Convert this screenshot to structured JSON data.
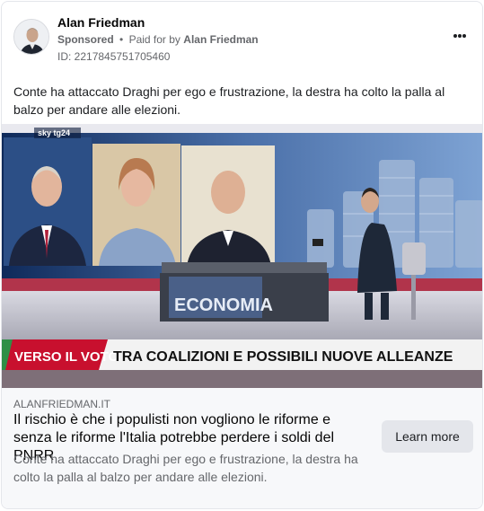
{
  "post": {
    "page_name": "Alan Friedman",
    "sponsored_label": "Sponsored",
    "separator": "•",
    "paid_for_prefix": "Paid for by",
    "payer_name": "Alan Friedman",
    "ad_id": "ID: 2217845751705460",
    "primary_text": "Conte ha attaccato Draghi per ego e frustrazione, la destra ha colto la palla al balzo per andare alle elezioni.",
    "more_icon": "ellipsis-icon"
  },
  "media": {
    "channel_logo": "sky tg24",
    "desk_logo": "ECONOMIA",
    "lower_third_tag": "VERSO IL VOTO",
    "lower_third_headline": "TRA COALIZIONI E POSSIBILI NUOVE ALLEANZE",
    "colors": {
      "tag_red": "#c8102e",
      "studio_blue": "#1d3a6e",
      "bar_white": "#f2f2f2"
    }
  },
  "link": {
    "domain": "ALANFRIEDMAN.IT",
    "headline": "Il rischio è che i populisti non vogliono le riforme e senza le riforme l'Italia potrebbe perdere i soldi del PNRR",
    "description": "Conte ha attaccato Draghi per ego e frustrazione, la destra ha colto la palla al balzo per andare alle elezioni.",
    "cta_label": "Learn more"
  }
}
